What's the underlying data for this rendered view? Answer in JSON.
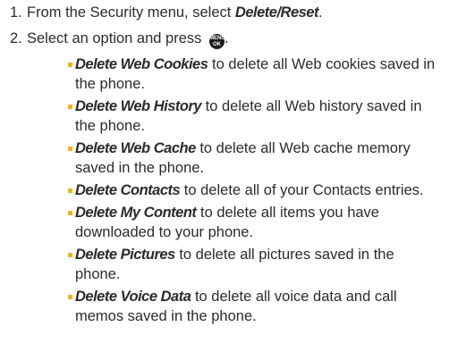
{
  "steps": [
    {
      "number": "1.",
      "prefix": "From the Security menu, select ",
      "term": "Delete/Reset",
      "suffix": "."
    },
    {
      "number": "2.",
      "prefix": "Select an option and press ",
      "key_top": "MENU",
      "key_bottom": "OK",
      "suffix": "."
    }
  ],
  "options": [
    {
      "term": "Delete Web Cookies",
      "desc": " to delete all Web cookies saved in the phone."
    },
    {
      "term": "Delete Web History",
      "desc": " to delete all Web history saved in the phone."
    },
    {
      "term": "Delete Web Cache",
      "desc": " to delete all Web cache memory saved in the phone."
    },
    {
      "term": "Delete Contacts",
      "desc": " to delete all of your Contacts entries."
    },
    {
      "term": "Delete My Content",
      "desc": " to delete all items you have downloaded to your phone."
    },
    {
      "term": "Delete Pictures",
      "desc": " to delete all pictures saved in the phone."
    },
    {
      "term": "Delete Voice Data",
      "desc": " to delete all voice data and call memos saved in the phone."
    }
  ],
  "colors": {
    "text": "#2b2b2b",
    "bullet": "#f3b21a",
    "key_background": "#1a1a1a"
  },
  "icons": {
    "bullet": "square-bullet-icon",
    "menu_key": "menu-ok-key-icon"
  }
}
